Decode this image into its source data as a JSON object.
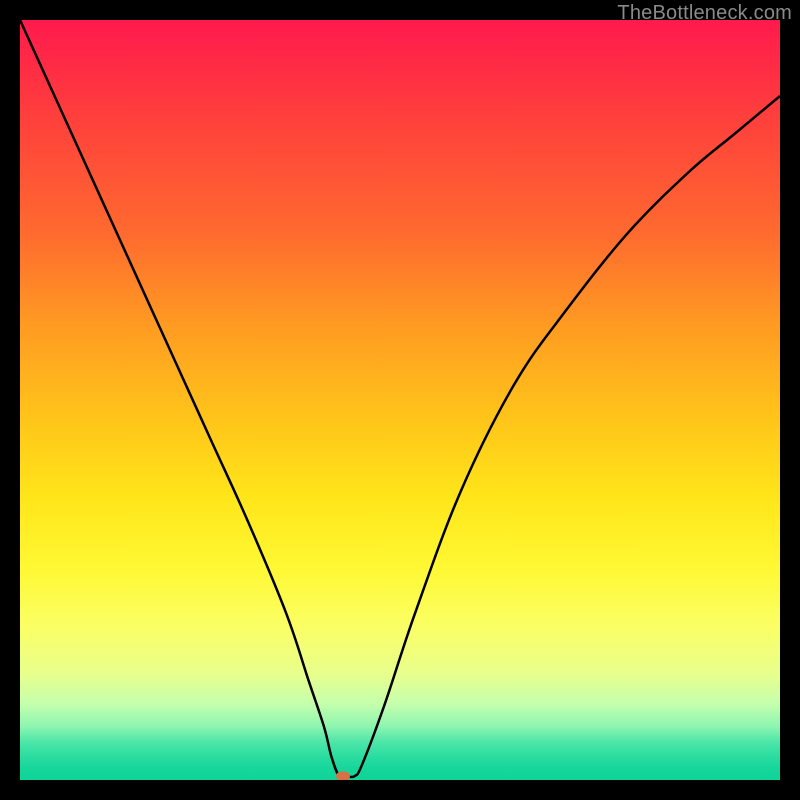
{
  "watermark": "TheBottleneck.com",
  "chart_data": {
    "type": "line",
    "title": "",
    "xlabel": "",
    "ylabel": "",
    "xlim": [
      0,
      100
    ],
    "ylim": [
      0,
      100
    ],
    "series": [
      {
        "name": "bottleneck-curve",
        "x": [
          0,
          5,
          10,
          15,
          20,
          25,
          30,
          35,
          38,
          40,
          41,
          42,
          43,
          44,
          45,
          48,
          52,
          58,
          65,
          72,
          80,
          88,
          94,
          100
        ],
        "values": [
          100,
          89,
          78,
          67,
          56,
          45,
          34,
          22,
          13,
          7,
          3,
          0.5,
          0.5,
          0.5,
          2,
          10,
          22,
          38,
          52,
          62,
          72,
          80,
          85,
          90
        ]
      }
    ],
    "marker": {
      "x": 42.5,
      "y": 0.5,
      "color": "#d77247"
    },
    "background_gradient": [
      "#ff1a4d",
      "#ff6a2f",
      "#ffe61a",
      "#faff66",
      "#8cf5b0",
      "#0fd49a"
    ]
  }
}
